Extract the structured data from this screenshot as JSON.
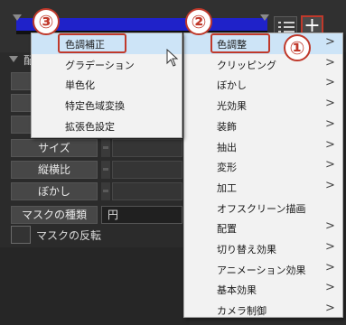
{
  "window": {
    "section_label": "配"
  },
  "toolbar": {
    "add_button_glyph": "+"
  },
  "properties": {
    "size_label": "サイズ",
    "aspect_label": "縦横比",
    "blur_label": "ぼかし",
    "mask_type_label": "マスクの種類",
    "mask_type_value": "円",
    "mask_invert_label": "マスクの反転"
  },
  "main_menu": {
    "items": [
      {
        "label": "色調整",
        "has_submenu": true
      },
      {
        "label": "クリッピング",
        "has_submenu": true
      },
      {
        "label": "ぼかし",
        "has_submenu": true
      },
      {
        "label": "光効果",
        "has_submenu": true
      },
      {
        "label": "装飾",
        "has_submenu": true
      },
      {
        "label": "抽出",
        "has_submenu": true
      },
      {
        "label": "変形",
        "has_submenu": true
      },
      {
        "label": "加工",
        "has_submenu": true
      },
      {
        "label": "オフスクリーン描画",
        "has_submenu": false
      },
      {
        "label": "配置",
        "has_submenu": true
      },
      {
        "label": "切り替え効果",
        "has_submenu": true
      },
      {
        "label": "アニメーション効果",
        "has_submenu": true
      },
      {
        "label": "基本効果",
        "has_submenu": true
      },
      {
        "label": "カメラ制御",
        "has_submenu": true
      }
    ],
    "chevron": ">"
  },
  "sub_menu": {
    "items": [
      {
        "label": "色調補正"
      },
      {
        "label": "グラデーション"
      },
      {
        "label": "単色化"
      },
      {
        "label": "特定色域変換"
      },
      {
        "label": "拡張色設定"
      }
    ]
  },
  "callouts": {
    "step1": "①",
    "step2": "②",
    "step3": "③"
  },
  "colors": {
    "highlight": "#cde4f7",
    "annotation_red": "#c0392b",
    "layer_blue": "#1f22c9"
  }
}
